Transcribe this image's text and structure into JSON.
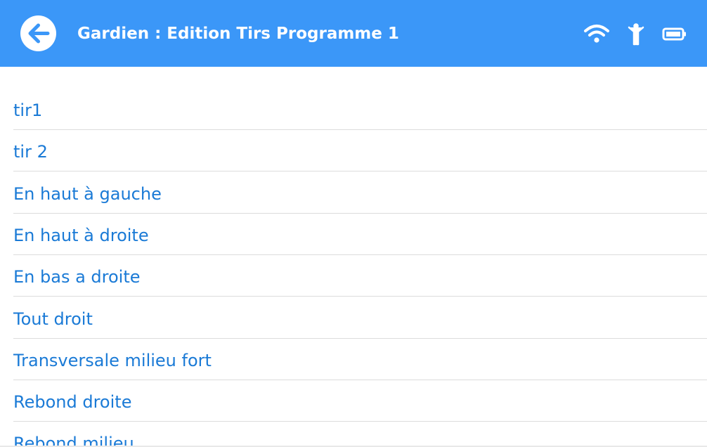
{
  "header": {
    "title": "Gardien : Edition Tirs Programme 1",
    "background_color": "#3b97f8",
    "back_icon": "arrow-left-circle-icon",
    "status_icons": [
      "wifi-icon",
      "person-icon",
      "battery-icon"
    ]
  },
  "list": {
    "text_color": "#1a7ad6",
    "items": [
      {
        "label": "tir1"
      },
      {
        "label": "tir 2"
      },
      {
        "label": "En haut à gauche"
      },
      {
        "label": "En haut à droite"
      },
      {
        "label": "En bas a droite"
      },
      {
        "label": "Tout droit"
      },
      {
        "label": "Transversale milieu fort"
      },
      {
        "label": "Rebond droite"
      },
      {
        "label": "Rebond milieu"
      }
    ]
  }
}
